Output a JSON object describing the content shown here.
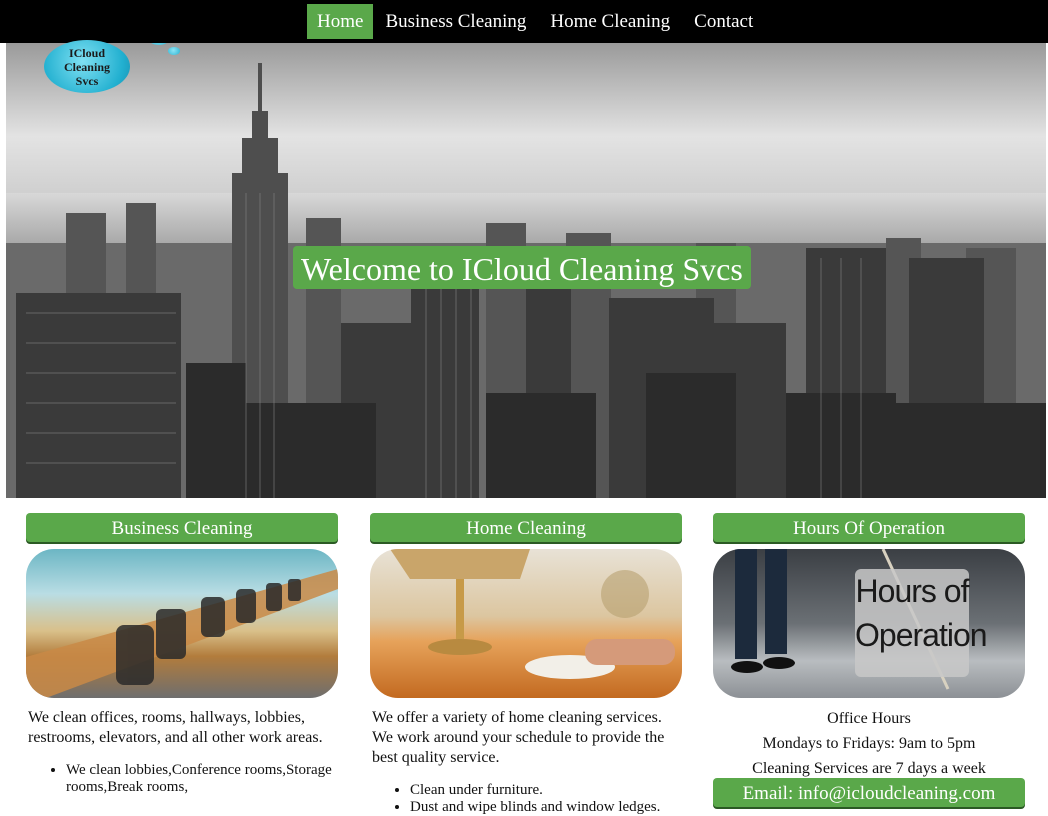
{
  "nav": {
    "items": [
      {
        "label": "Home",
        "active": true
      },
      {
        "label": "Business Cleaning",
        "active": false
      },
      {
        "label": "Home Cleaning",
        "active": false
      },
      {
        "label": "Contact",
        "active": false
      }
    ]
  },
  "logo": {
    "line1": "ICloud",
    "line2": "Cleaning",
    "line3": "Svcs"
  },
  "hero": {
    "headline": "Welcome to ICloud Cleaning Svcs"
  },
  "business": {
    "title": "Business Cleaning",
    "description": "We clean offices, rooms, hallways, lobbies, restrooms, elevators, and all other work areas.",
    "bullets": [
      "We clean lobbies,Conference rooms,Storage rooms,Break rooms,"
    ]
  },
  "home": {
    "title": "Home Cleaning",
    "description": "We offer a variety of home cleaning services. We work around your schedule to provide the best quality service.",
    "bullets": [
      "Clean under furniture.",
      "Dust and wipe blinds and window ledges."
    ]
  },
  "hours": {
    "title": "Hours Of Operation",
    "sign_line1": "Hours of",
    "sign_line2": "Operation",
    "office_hours_label": "Office Hours",
    "weekday_hours": "Mondays to Fridays: 9am to 5pm",
    "cleaning_days": "Cleaning Services are 7 days a week",
    "email": "Email: info@icloudcleaning.com"
  },
  "colors": {
    "accent": "#5aa84a",
    "nav_bg": "#000000"
  }
}
